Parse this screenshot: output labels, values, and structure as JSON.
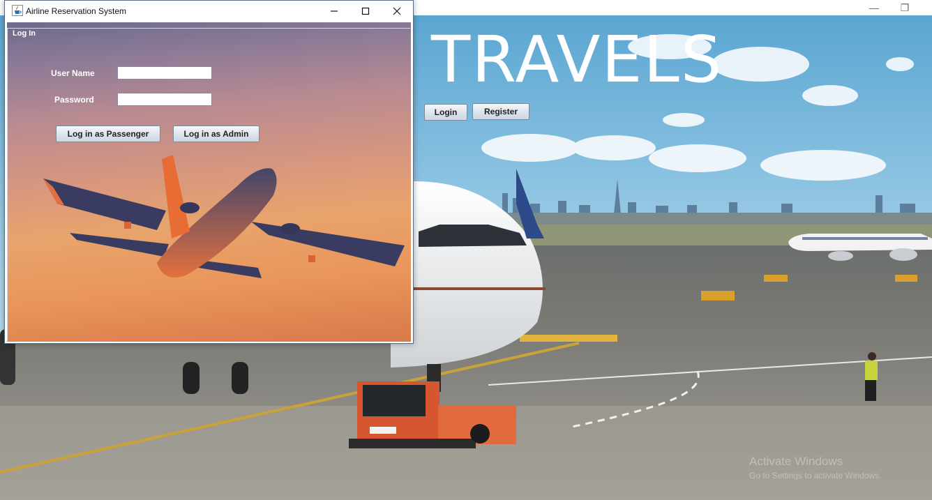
{
  "main_window": {
    "controls": {
      "minimize": "—",
      "restore": "❐"
    },
    "hero_title": "TRAVELS",
    "login_button": "Login",
    "register_button": "Register",
    "watermark": {
      "line1": "Activate Windows",
      "line2": "Go to Settings to activate Windows."
    }
  },
  "dialog": {
    "title": "Airline Reservation System",
    "controls": {
      "minimize": "—",
      "maximize": "☐",
      "close": "✕"
    },
    "group_title": "Log In",
    "username_label": "User Name",
    "username_value": "",
    "password_label": "Password",
    "password_value": "",
    "passenger_button": "Log in as Passenger",
    "admin_button": "Log in as Admin"
  },
  "colors": {
    "sky": "#76b7d8",
    "tarmac": "#8c8a84",
    "sunset_top": "#6c6a8c",
    "sunset_bottom": "#d8794a",
    "button_border": "#7a8a99"
  }
}
